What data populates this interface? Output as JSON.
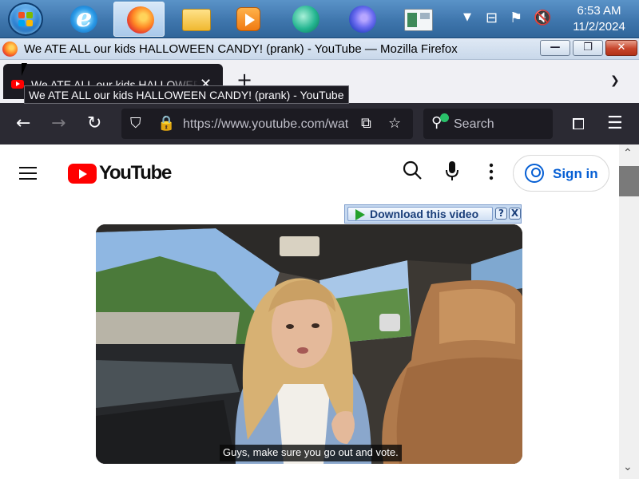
{
  "taskbar": {
    "clock_time": "6:53 AM",
    "clock_date": "11/2/2024",
    "pinned": [
      "internet-explorer-icon",
      "firefox-icon",
      "file-explorer-icon",
      "media-player-icon",
      "app-icon",
      "firefox-developer-icon",
      "window-app-icon"
    ],
    "tray_icons": [
      "show-hidden-icons-icon",
      "network-icon",
      "action-center-flag-icon",
      "volume-muted-icon"
    ]
  },
  "window": {
    "title": "We ATE ALL our kids HALLOWEEN CANDY! (prank) - YouTube — Mozilla Firefox",
    "minimize_label": "—",
    "maximize_label": "❐",
    "close_label": "✕"
  },
  "tabs": {
    "active_title": "We ATE ALL our kids HALLOWEEN CANDY! (prank) - YouTube",
    "new_tab_label": "+",
    "tooltip": "We ATE ALL our kids HALLOWEEN CANDY! (prank) - YouTube"
  },
  "toolbar": {
    "url": "https://www.youtube.com/watch",
    "search_placeholder": "Search"
  },
  "youtube": {
    "logo_text": "YouTube",
    "sign_in_label": "Sign in"
  },
  "download_bar": {
    "label": "Download this video",
    "help_label": "?",
    "close_label": "X"
  },
  "video": {
    "caption": "Guys, make sure you go out and vote."
  },
  "colors": {
    "youtube_red": "#ff0000",
    "signin_blue": "#065fd4",
    "firefox_dark": "#1c1b22",
    "taskbar_blue": "#3f76ad"
  }
}
